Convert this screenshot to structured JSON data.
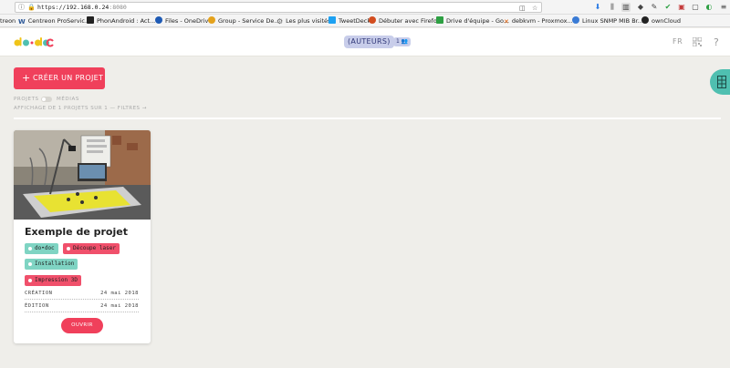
{
  "browser": {
    "url": {
      "scheme": "https://",
      "host": "192.168.0.24",
      "port": ":8080"
    },
    "bookmarks": [
      {
        "label": "treon",
        "icon": "",
        "color": "#f4f4f4"
      },
      {
        "label": "Centreon ProServic...",
        "icon": "W",
        "color": "#2b5797"
      },
      {
        "label": "PhonAndroid : Act...",
        "icon": "P",
        "color": "#222222"
      },
      {
        "label": "Files - OneDrive",
        "icon": "cloud",
        "color": "#1e5ab4"
      },
      {
        "label": "Group - Service De...",
        "icon": "G",
        "color": "#e4a21c"
      },
      {
        "label": "Les plus visités",
        "icon": "gear",
        "color": "#666666"
      },
      {
        "label": "TweetDeck",
        "icon": "T",
        "color": "#1da1f2"
      },
      {
        "label": "Débuter avec Firefox",
        "icon": "F",
        "color": "#d34d1f"
      },
      {
        "label": "Drive d'équipe - Go...",
        "icon": "D",
        "color": "#2ea043"
      },
      {
        "label": "debkvm - Proxmox...",
        "icon": "X",
        "color": "#e05a00"
      },
      {
        "label": "Linux SNMP MIB Br...",
        "icon": "L",
        "color": "#3a7bd5"
      },
      {
        "label": "ownCloud",
        "icon": "O",
        "color": "#222222"
      }
    ]
  },
  "header": {
    "authors_label": "(AUTEURS)",
    "authors_count": "1",
    "lang": "FR"
  },
  "main": {
    "create_label": "CRÉER UN PROJET",
    "toggle_projects": "PROJETS",
    "toggle_media": "MÉDIAS",
    "filter_text": "AFFICHAGE DE 1 PROJETS SUR 1 — FILTRES",
    "filter_arrow": "→"
  },
  "project": {
    "title": "Exemple de projet",
    "tags": [
      {
        "label": "do•doc",
        "kind": "kw"
      },
      {
        "label": "Découpe laser",
        "kind": "cat"
      },
      {
        "label": "Installation",
        "kind": "kw"
      },
      {
        "label": "Impression 3D",
        "kind": "cat"
      }
    ],
    "created_label": "CRÉATION",
    "created_date": "24 mai 2018",
    "edited_label": "ÉDITION",
    "edited_date": "24 mai 2018",
    "open_label": "OUVRIR"
  },
  "colors": {
    "accent": "#f0405b",
    "teal": "#4fbfb0",
    "keyword": "#7fd4c3",
    "authors": "#c8cdea"
  }
}
